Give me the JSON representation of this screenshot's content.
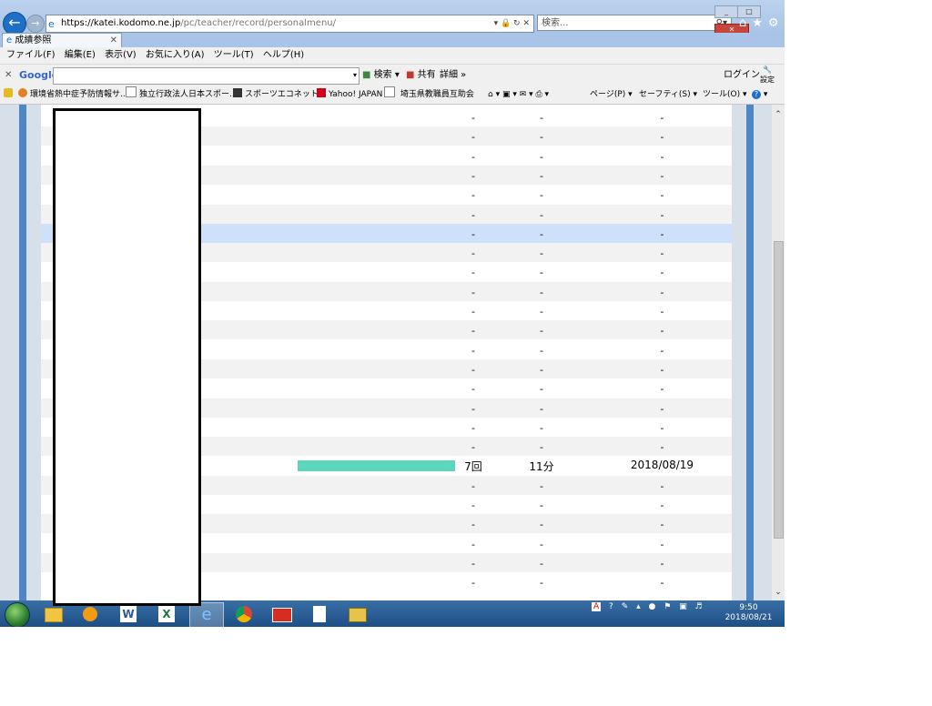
{
  "browser": {
    "address": {
      "host": "https://katei.kodomo.ne.jp",
      "path": "/pc/teacher/record/personalmenu/"
    },
    "search_placeholder": "検索...",
    "tab_title": "成績参照"
  },
  "menubar": [
    "ファイル(F)",
    "編集(E)",
    "表示(V)",
    "お気に入り(A)",
    "ツール(T)",
    "ヘルプ(H)"
  ],
  "google_toolbar": {
    "logo": "Google",
    "search_label": "検索",
    "share_label": "共有",
    "more_label": "詳細",
    "login_label": "ログイン",
    "settings_label": "設定"
  },
  "favorites": [
    "環境省熱中症予防情報サ...",
    "独立行政法人日本スポー...",
    "スポーツエコネット",
    "Yahoo! JAPAN",
    "埼玉県教職員互助会"
  ],
  "command_bar": [
    "ページ(P)",
    "セーフティ(S)",
    "ツール(O)"
  ],
  "rows": [
    {
      "count": "-",
      "time": "-",
      "date": "-"
    },
    {
      "count": "-",
      "time": "-",
      "date": "-"
    },
    {
      "count": "-",
      "time": "-",
      "date": "-"
    },
    {
      "count": "-",
      "time": "-",
      "date": "-"
    },
    {
      "count": "-",
      "time": "-",
      "date": "-"
    },
    {
      "count": "-",
      "time": "-",
      "date": "-"
    },
    {
      "count": "-",
      "time": "-",
      "date": "-",
      "highlighted": true
    },
    {
      "count": "-",
      "time": "-",
      "date": "-"
    },
    {
      "count": "-",
      "time": "-",
      "date": "-"
    },
    {
      "count": "-",
      "time": "-",
      "date": "-"
    },
    {
      "count": "-",
      "time": "-",
      "date": "-"
    },
    {
      "count": "-",
      "time": "-",
      "date": "-"
    },
    {
      "count": "-",
      "time": "-",
      "date": "-"
    },
    {
      "count": "-",
      "time": "-",
      "date": "-"
    },
    {
      "count": "-",
      "time": "-",
      "date": "-"
    },
    {
      "count": "-",
      "time": "-",
      "date": "-"
    },
    {
      "count": "-",
      "time": "-",
      "date": "-"
    },
    {
      "count": "-",
      "time": "-",
      "date": "-"
    },
    {
      "count": "7回",
      "time": "11分",
      "date": "2018/08/19",
      "progress": 1.0
    },
    {
      "count": "-",
      "time": "-",
      "date": "-"
    },
    {
      "count": "-",
      "time": "-",
      "date": "-"
    },
    {
      "count": "-",
      "time": "-",
      "date": "-"
    },
    {
      "count": "-",
      "time": "-",
      "date": "-"
    },
    {
      "count": "-",
      "time": "-",
      "date": "-"
    },
    {
      "count": "-",
      "time": "-",
      "date": "-"
    }
  ],
  "taskbar": {
    "apps": [
      "explorer-icon",
      "media-player-icon",
      "word-icon",
      "excel-icon",
      "ie-icon",
      "chrome-icon",
      "app-red-icon",
      "document-icon",
      "app-yellow-icon"
    ],
    "clock_time": "9:50",
    "clock_date": "2018/08/21"
  },
  "colors": {
    "accent": "#4f86c6",
    "progress": "#5ed6bd",
    "highlight": "#cfe0fb"
  }
}
